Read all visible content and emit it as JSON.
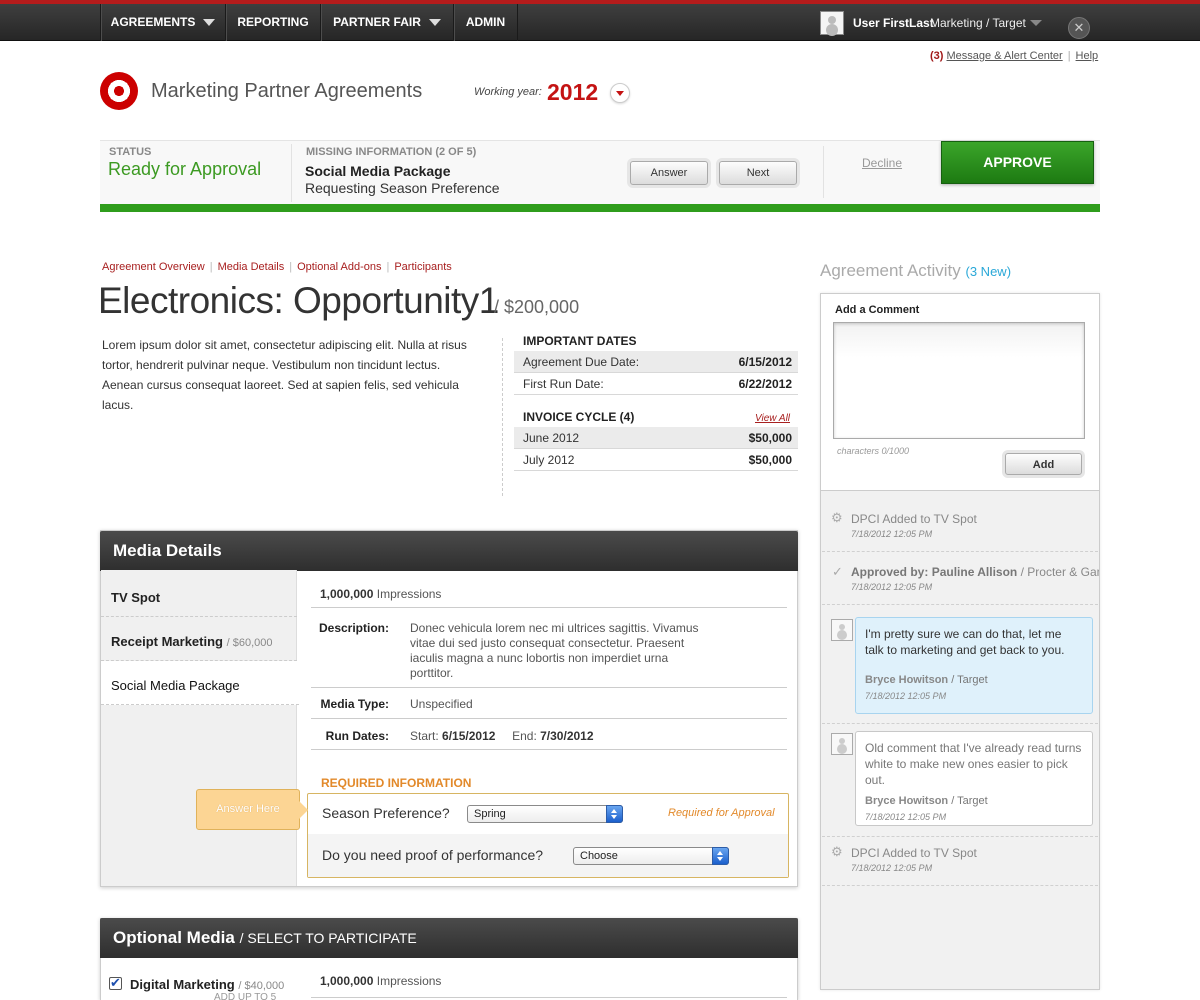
{
  "nav": {
    "items": [
      {
        "label": "AGREEMENTS",
        "dropdown": true
      },
      {
        "label": "REPORTING",
        "dropdown": false
      },
      {
        "label": "PARTNER FAIR",
        "dropdown": true
      },
      {
        "label": "ADMIN",
        "dropdown": false
      }
    ],
    "user_name": "User FirstLast",
    "user_role": "Marketing / Target",
    "close_symbol": "✕"
  },
  "header": {
    "alert_count": "(3)",
    "alert_link": "Message & Alert Center",
    "help_link": "Help",
    "app_title": "Marketing Partner Agreements",
    "working_year_label": "Working year:",
    "working_year": "2012"
  },
  "status": {
    "label": "STATUS",
    "value": "Ready for Approval",
    "missing_label": "MISSING INFORMATION (2 of 5)",
    "missing_title": "Social Media Package",
    "missing_sub": "Requesting Season Preference",
    "answer_label": "Answer",
    "next_label": "Next",
    "decline_label": "Decline",
    "approve_label": "APPROVE"
  },
  "breadcrumb": [
    "Agreement Overview",
    "Media Details",
    "Optional Add-ons",
    "Participants"
  ],
  "page": {
    "title": "Electronics: Opportunity1",
    "amount": "/ $200,000",
    "description": "Lorem ipsum dolor sit amet, consectetur adipiscing elit. Nulla at risus tortor, hendrerit pulvinar neque. Vestibulum non tincidunt lectus. Aenean cursus consequat laoreet. Sed at sapien felis, sed vehicula lacus."
  },
  "important_dates": {
    "title": "IMPORTANT DATES",
    "rows": [
      {
        "label": "Agreement Due Date:",
        "value": "6/15/2012"
      },
      {
        "label": "First Run Date:",
        "value": "6/22/2012"
      }
    ]
  },
  "invoice_cycle": {
    "title": "INVOICE CYCLE (4)",
    "view_all": "View All",
    "rows": [
      {
        "label": "June 2012",
        "value": "$50,000"
      },
      {
        "label": "July 2012",
        "value": "$50,000"
      }
    ]
  },
  "media_details": {
    "title": "Media Details",
    "items": [
      {
        "name": "TV Spot",
        "price": ""
      },
      {
        "name": "Receipt Marketing",
        "price": "/ $60,000"
      },
      {
        "name": "Social Media Package",
        "price": ""
      }
    ],
    "impressions_value": "1,000,000",
    "impressions_label": "Impressions",
    "description_label": "Description:",
    "description_value": "Donec vehicula lorem nec mi ultrices sagittis. Vivamus vitae dui sed justo consequat consectetur. Praesent iaculis magna a nunc lobortis non imperdiet urna porttitor.",
    "media_type_label": "Media Type:",
    "media_type_value": "Unspecified",
    "run_dates_label": "Run Dates:",
    "start_label": "Start:",
    "start_value": "6/15/2012",
    "end_label": "End:",
    "end_value": "7/30/2012",
    "required_title": "REQUIRED INFORMATION",
    "callout": "Answer Here",
    "season_label": "Season Preference?",
    "season_value": "Spring",
    "required_note": "Required for Approval",
    "proof_label": "Do you need proof of performance?",
    "proof_value": "Choose"
  },
  "optional_media": {
    "title": "Optional Media",
    "subtitle": "/ SELECT TO PARTICIPATE",
    "item_name": "Digital Marketing",
    "item_price": "/ $40,000",
    "item_note": "ADD UP TO 5",
    "impressions_value": "1,000,000",
    "impressions_label": "Impressions"
  },
  "activity": {
    "title": "Agreement Activity",
    "new_count": "(3 New)",
    "comment_label": "Add a Comment",
    "char_count": "characters 0/1000",
    "add_label": "Add",
    "entries": [
      {
        "text": "DPCI Added to TV Spot",
        "time": "7/18/2012 12:05 PM"
      },
      {
        "prefix": "Approved by:",
        "who": "Pauline Allison",
        "org": "/ Procter & Gamble",
        "time": "7/18/2012 12:05 PM"
      },
      {
        "text": "I'm pretty sure we can do that, let me talk to marketing and get back to you.",
        "who": "Bryce Howitson",
        "org": "/ Target",
        "time": "7/18/2012 12:05 PM"
      },
      {
        "text": "Old comment that I've already read turns white to make new ones easier to pick out.",
        "who": "Bryce Howitson",
        "org": "/ Target",
        "time": "7/18/2012 12:05 PM"
      },
      {
        "text": "DPCI Added to TV Spot",
        "time": "7/18/2012 12:05 PM"
      }
    ]
  }
}
